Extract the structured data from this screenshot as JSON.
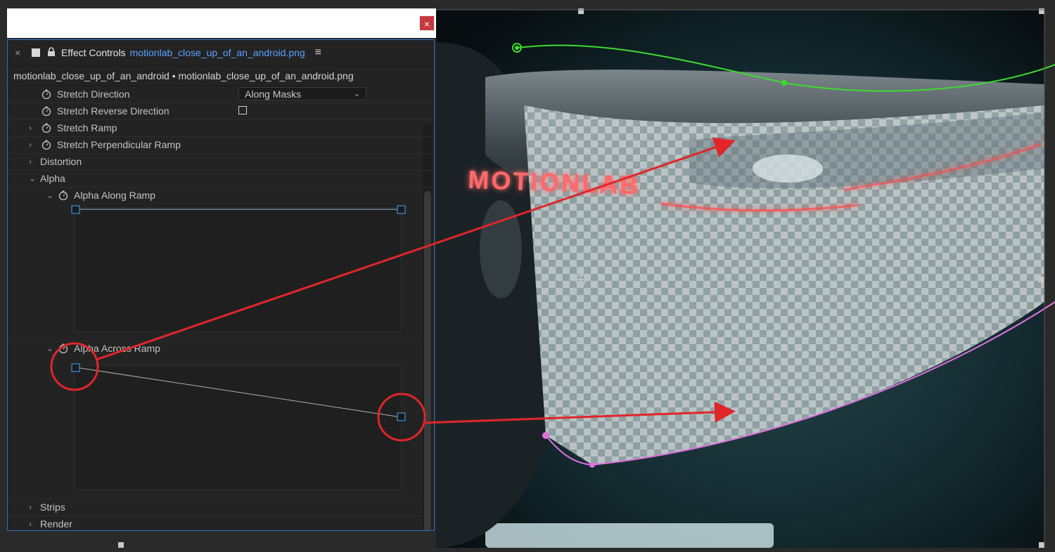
{
  "panel": {
    "tab_title": "Effect Controls",
    "tab_file": "motionlab_close_up_of_an_android.png",
    "breadcrumb": "motionlab_close_up_of_an_android • motionlab_close_up_of_an_android.png",
    "close_glyph": "×",
    "window_close_glyph": "×",
    "menu_glyph": "≡"
  },
  "properties": {
    "stretch_direction": {
      "label": "Stretch Direction",
      "value": "Along Masks"
    },
    "stretch_reverse": {
      "label": "Stretch Reverse Direction",
      "checked": false
    },
    "stretch_ramp": {
      "label": "Stretch Ramp"
    },
    "stretch_perp_ramp": {
      "label": "Stretch Perpendicular Ramp"
    },
    "distortion": {
      "label": "Distortion"
    },
    "alpha": {
      "label": "Alpha"
    },
    "alpha_along_ramp": {
      "label": "Alpha Along Ramp"
    },
    "alpha_across_ramp": {
      "label": "Alpha Across Ramp"
    },
    "strips": {
      "label": "Strips"
    },
    "render": {
      "label": "Render"
    }
  },
  "viewer": {
    "neon_text": "MOTIONLAB",
    "upper_mask_color": "#3ddc2e",
    "lower_mask_color": "#e070e0",
    "annotation_color": "#e0262a"
  },
  "icons": [
    "stopwatch-icon",
    "twirl-right-icon",
    "twirl-down-icon",
    "lock-icon",
    "menu-icon",
    "close-icon",
    "anchor-point-icon",
    "ramp-handle-icon"
  ]
}
